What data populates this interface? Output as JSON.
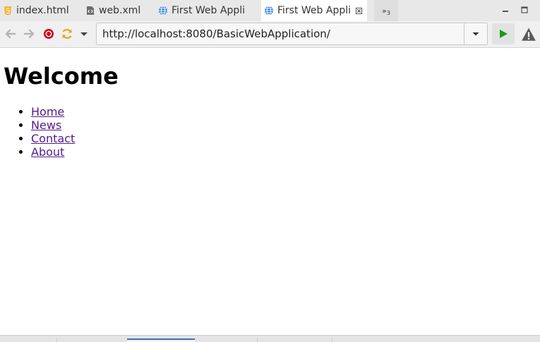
{
  "tabs": [
    {
      "label": "index.html",
      "icon": "html5-file-icon"
    },
    {
      "label": "web.xml",
      "icon": "xml-file-icon"
    },
    {
      "label": "First Web Appli",
      "icon": "globe-icon"
    },
    {
      "label": "First Web Appli",
      "icon": "globe-icon",
      "active": true
    }
  ],
  "tab_overflow": {
    "symbol": "»",
    "count": "3"
  },
  "toolbar": {
    "url": "http://localhost:8080/BasicWebApplication/"
  },
  "page": {
    "heading": "Welcome",
    "links": [
      "Home",
      "News",
      "Contact",
      "About"
    ]
  },
  "colors": {
    "stop": "#d0021b",
    "refresh": "#e6a817",
    "go": "#1a9c1a",
    "globe": "#2a7be0",
    "visited_link": "#551a8b"
  }
}
